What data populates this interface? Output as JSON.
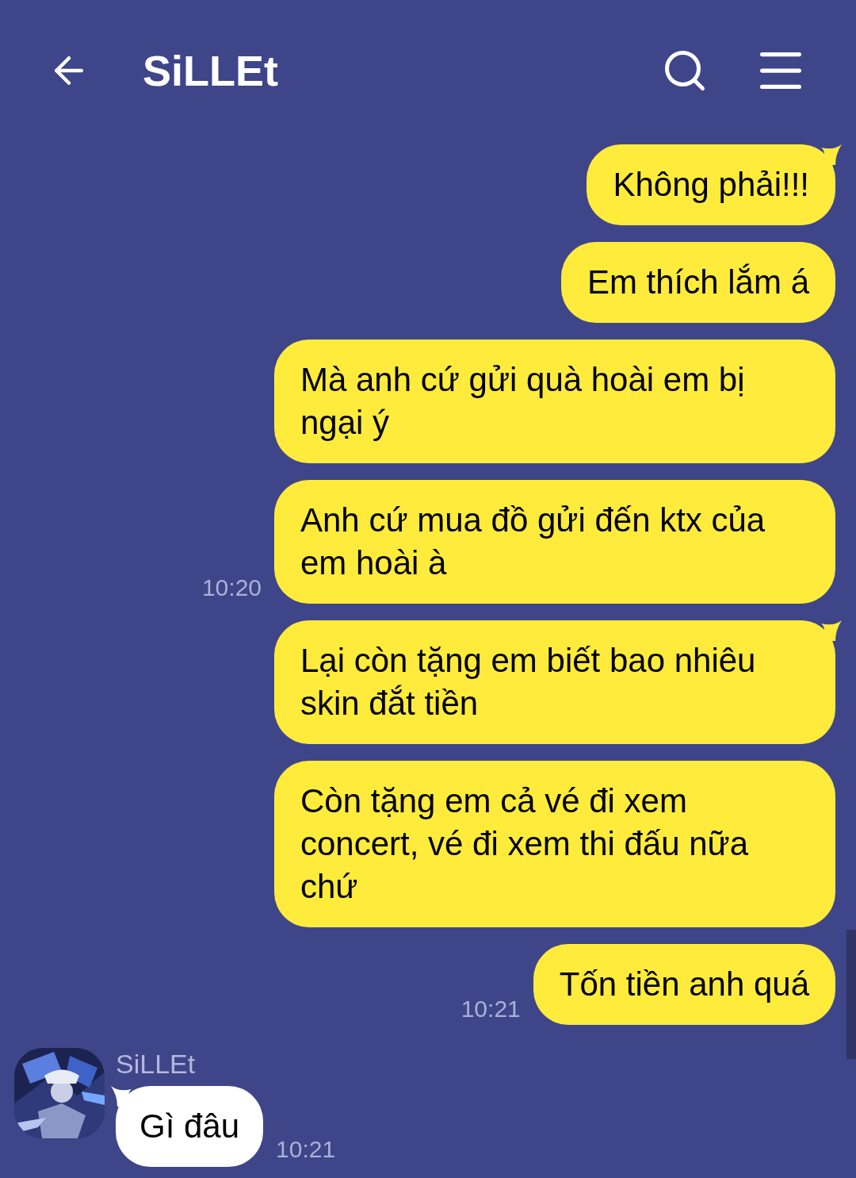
{
  "header": {
    "title": "SiLLEt"
  },
  "outgoing": [
    {
      "text": "Không phải!!!",
      "tail": true
    },
    {
      "text": "Em thích lắm á",
      "tail": false
    },
    {
      "text": "Mà anh cứ gửi quà hoài em bị ngại ý",
      "tail": false
    },
    {
      "text": "Anh cứ mua đồ gửi đến ktx của em hoài à",
      "tail": false,
      "time": "10:20"
    },
    {
      "text": "Lại còn tặng em biết bao nhiêu skin đắt tiền",
      "tail": true
    },
    {
      "text": "Còn tặng em cả vé đi xem concert, vé đi xem thi đấu nữa chứ",
      "tail": false
    },
    {
      "text": "Tốn tiền anh quá",
      "tail": false,
      "time": "10:21"
    }
  ],
  "incoming": [
    {
      "sender": "SiLLEt",
      "text": "Gì đâu",
      "tail": true,
      "time": "10:21"
    }
  ]
}
